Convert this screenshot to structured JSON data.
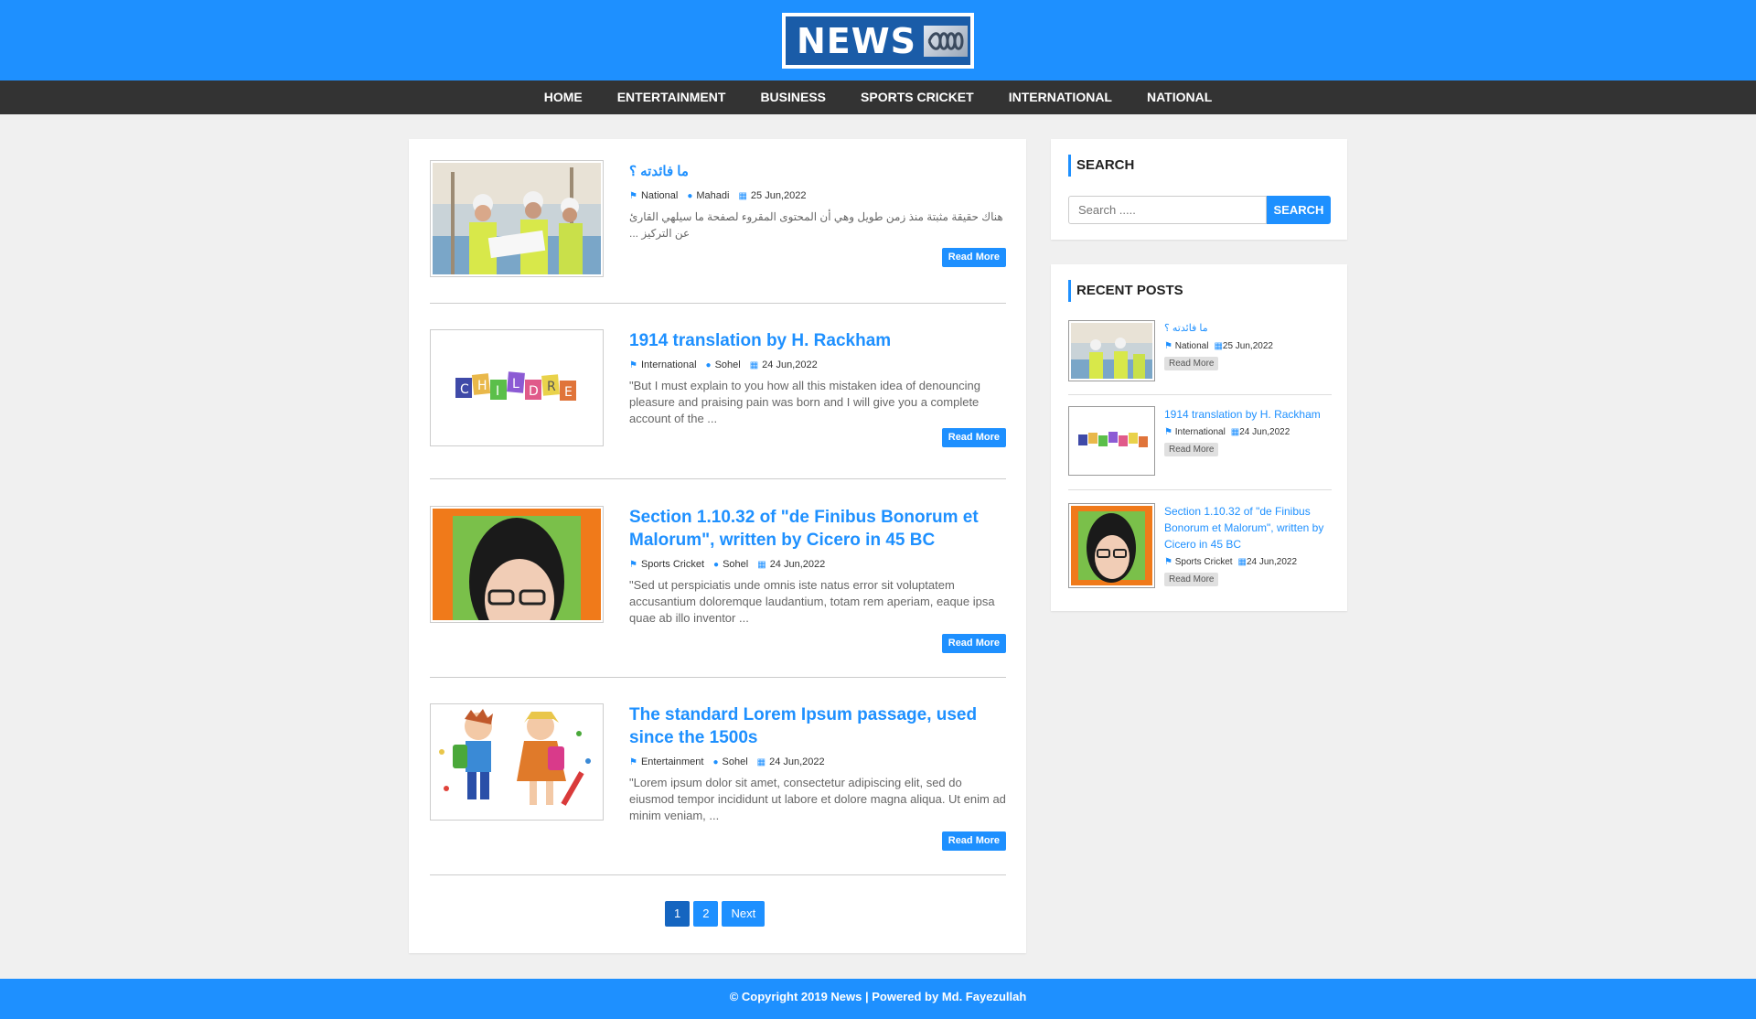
{
  "header": {
    "logo_text": "NEWS",
    "logo_mark": "abc-logo-icon"
  },
  "nav": {
    "items": [
      {
        "label": "HOME"
      },
      {
        "label": "ENTERTAINMENT"
      },
      {
        "label": "BUSINESS"
      },
      {
        "label": "SPORTS CRICKET"
      },
      {
        "label": "INTERNATIONAL"
      },
      {
        "label": "NATIONAL"
      }
    ]
  },
  "posts": [
    {
      "title": "ما فائدته ؟",
      "category": "National",
      "author": "Mahadi",
      "date": "25 Jun,2022",
      "excerpt": "هناك حقيقة مثبتة منذ زمن طويل وهي أن المحتوى المقروء لصفحة ما سيلهي القارئ عن التركيز ...",
      "read_more": "Read More",
      "image": "construction-workers-image"
    },
    {
      "title": "1914 translation by H. Rackham",
      "category": "International",
      "author": "Sohel",
      "date": "24 Jun,2022",
      "excerpt": "\"But I must explain to you how all this mistaken idea of denouncing pleasure and praising pain was born and I will give you a complete account of the ...",
      "read_more": "Read More",
      "image": "children-letters-image"
    },
    {
      "title": "Section 1.10.32 of \"de Finibus Bonorum et Malorum\", written by Cicero in 45 BC",
      "category": "Sports Cricket",
      "author": "Sohel",
      "date": "24 Jun,2022",
      "excerpt": "\"Sed ut perspiciatis unde omnis iste natus error sit voluptatem accusantium doloremque laudantium, totam rem aperiam, eaque ipsa quae ab illo inventor ...",
      "read_more": "Read More",
      "image": "girl-portrait-image"
    },
    {
      "title": "The standard Lorem Ipsum passage, used since the 1500s",
      "category": "Entertainment",
      "author": "Sohel",
      "date": "24 Jun,2022",
      "excerpt": "\"Lorem ipsum dolor sit amet, consectetur adipiscing elit, sed do eiusmod tempor incididunt ut labore et dolore magna aliqua. Ut enim ad minim veniam, ...",
      "read_more": "Read More",
      "image": "cartoon-kids-image"
    }
  ],
  "pagination": {
    "pages": [
      "1",
      "2"
    ],
    "next": "Next",
    "current": "1"
  },
  "sidebar": {
    "search": {
      "title": "SEARCH",
      "placeholder": "Search .....",
      "button": "SEARCH"
    },
    "recent": {
      "title": "RECENT POSTS",
      "items": [
        {
          "title": "ما فائدته ؟",
          "category": "National",
          "date": "25 Jun,2022",
          "read_more": "Read More"
        },
        {
          "title": "1914 translation by H. Rackham",
          "category": "International",
          "date": "24 Jun,2022",
          "read_more": "Read More"
        },
        {
          "title": "Section 1.10.32 of \"de Finibus Bonorum et Malorum\", written by Cicero in 45 BC",
          "category": "Sports Cricket",
          "date": "24 Jun,2022",
          "read_more": "Read More"
        }
      ]
    }
  },
  "footer": {
    "text": "© Copyright 2019 News | Powered by Md. Fayezullah"
  },
  "colors": {
    "brand": "#1e90ff",
    "nav_bg": "#333333",
    "page_bg": "#f0f0f0"
  }
}
